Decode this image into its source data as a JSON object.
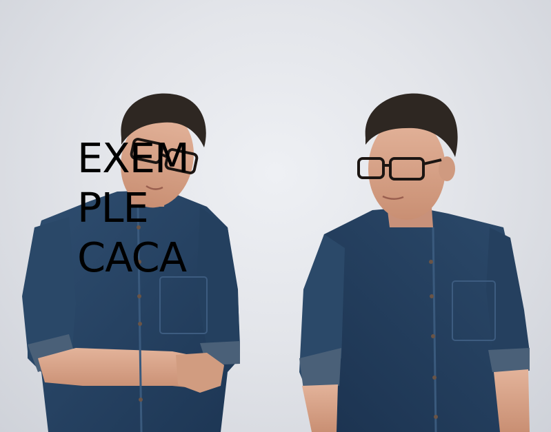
{
  "overlay": {
    "caption": "EXEM\nPLE\nCACA"
  },
  "scene": {
    "subject": "two-men-denim-shirts-glasses",
    "colors": {
      "background": "#e3e5ea",
      "denim": "#2a4766",
      "denim_dark": "#1c3350",
      "skin": "#d9a58a",
      "hair": "#2e2722",
      "glasses": "#1b1512"
    }
  }
}
